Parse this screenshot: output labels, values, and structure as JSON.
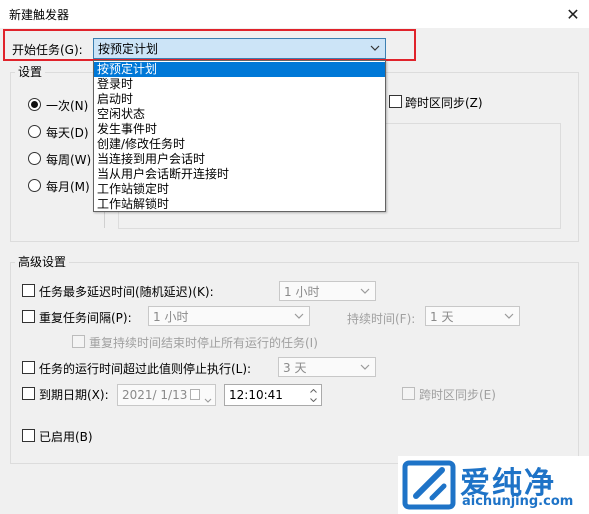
{
  "window": {
    "title": "新建触发器",
    "close_glyph": "✕"
  },
  "begin_task": {
    "label": "开始任务(G):",
    "selected": "按预定计划",
    "options": [
      "按预定计划",
      "登录时",
      "启动时",
      "空闲状态",
      "发生事件时",
      "创建/修改任务时",
      "当连接到用户会话时",
      "当从用户会话断开连接时",
      "工作站锁定时",
      "工作站解锁时"
    ],
    "highlight_color": "#e0232b"
  },
  "settings": {
    "legend": "设置",
    "radios": [
      {
        "label": "一次(N)",
        "checked": true
      },
      {
        "label": "每天(D)",
        "checked": false
      },
      {
        "label": "每周(W)",
        "checked": false
      },
      {
        "label": "每月(M)",
        "checked": false
      }
    ],
    "sync_timezone": "跨时区同步(Z)"
  },
  "advanced": {
    "legend": "高级设置",
    "delay_label": "任务最多延迟时间(随机延迟)(K):",
    "delay_value": "1 小时",
    "repeat_label": "重复任务间隔(P):",
    "repeat_value": "1 小时",
    "duration_label": "持续时间(F):",
    "duration_value": "1 天",
    "stop_all_label": "重复持续时间结束时停止所有运行的任务(I)",
    "stop_if_longer_label": "任务的运行时间超过此值则停止执行(L):",
    "stop_if_longer_value": "3 天",
    "expire_label": "到期日期(X):",
    "expire_date": "2021/ 1/13",
    "expire_time": "12:10:41",
    "expire_sync": "跨时区同步(E)",
    "enabled_label": "已启用(B)"
  },
  "watermark": {
    "brand": "爱纯净",
    "url": "aichunjing.com",
    "color": "#1e73c7"
  }
}
